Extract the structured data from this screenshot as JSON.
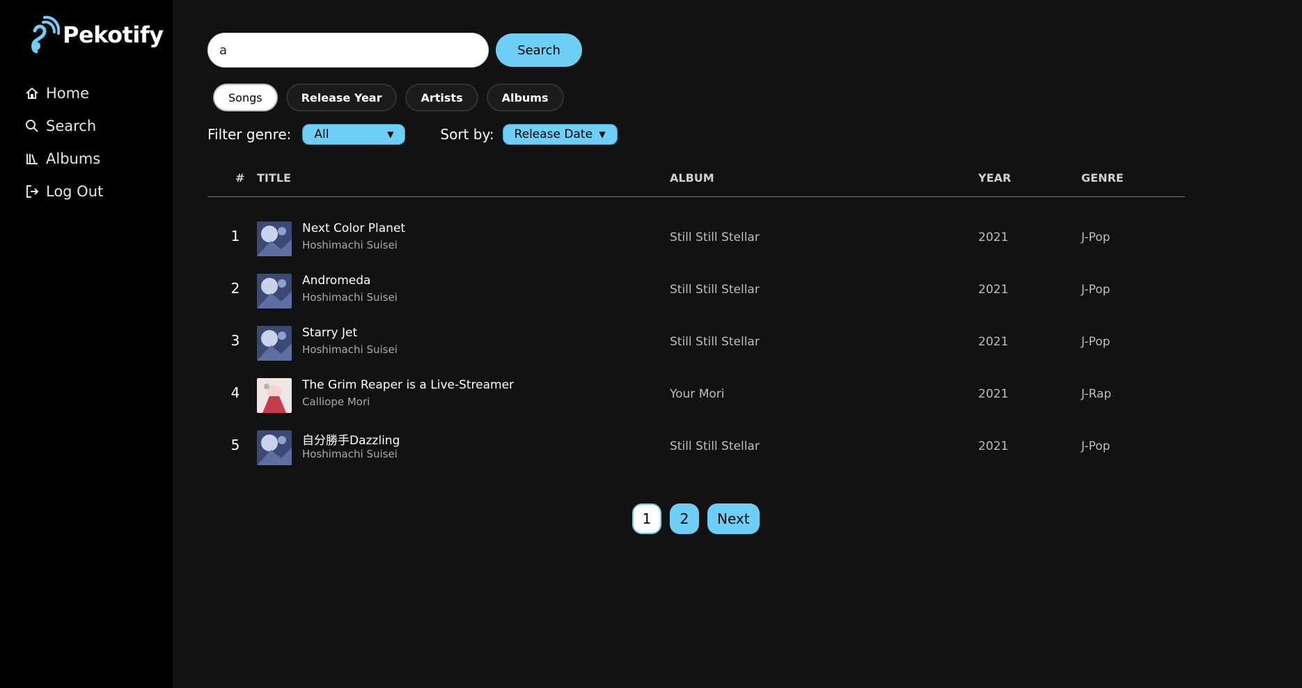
{
  "app": {
    "name": "Pekotify"
  },
  "colors": {
    "accent": "#6dcff6",
    "background": "#121212",
    "sidebar": "#000000"
  },
  "sidebar": {
    "items": [
      {
        "label": "Home",
        "icon": "home-icon"
      },
      {
        "label": "Search",
        "icon": "search-icon"
      },
      {
        "label": "Albums",
        "icon": "library-icon"
      },
      {
        "label": "Log Out",
        "icon": "logout-icon"
      }
    ]
  },
  "search": {
    "value": "a",
    "button_label": "Search"
  },
  "tabs": [
    {
      "label": "Songs",
      "active": true
    },
    {
      "label": "Release Year",
      "active": false
    },
    {
      "label": "Artists",
      "active": false
    },
    {
      "label": "Albums",
      "active": false
    }
  ],
  "filters": {
    "genre_label": "Filter genre:",
    "genre_value": "All",
    "sort_label": "Sort by:",
    "sort_value": "Release Date"
  },
  "table": {
    "headers": {
      "num": "#",
      "title": "TITLE",
      "album": "ALBUM",
      "year": "YEAR",
      "genre": "GENRE"
    },
    "rows": [
      {
        "num": "1",
        "title": "Next Color Planet",
        "artist": "Hoshimachi Suisei",
        "album": "Still Still Stellar",
        "year": "2021",
        "genre": "J-Pop"
      },
      {
        "num": "2",
        "title": "Andromeda",
        "artist": "Hoshimachi Suisei",
        "album": "Still Still Stellar",
        "year": "2021",
        "genre": "J-Pop"
      },
      {
        "num": "3",
        "title": "Starry Jet",
        "artist": "Hoshimachi Suisei",
        "album": "Still Still Stellar",
        "year": "2021",
        "genre": "J-Pop"
      },
      {
        "num": "4",
        "title": "The Grim Reaper is a Live-Streamer",
        "artist": "Calliope Mori",
        "album": "Your Mori",
        "year": "2021",
        "genre": "J-Rap"
      },
      {
        "num": "5",
        "title": "自分勝手Dazzling",
        "artist": "Hoshimachi Suisei",
        "album": "Still Still Stellar",
        "year": "2021",
        "genre": "J-Pop"
      }
    ]
  },
  "pagination": {
    "pages": [
      "1",
      "2"
    ],
    "current": "1",
    "next_label": "Next"
  }
}
